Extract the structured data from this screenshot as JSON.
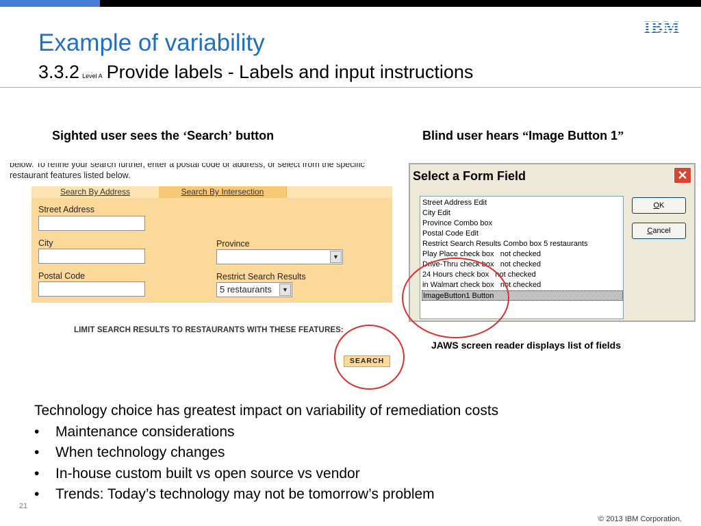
{
  "logo": {
    "text": "IBM",
    "color": "#1f70c1"
  },
  "title": {
    "main": "Example of variability",
    "sub_number": "3.3.2",
    "level": "Level A",
    "sub_text": "Provide labels -  Labels and input instructions"
  },
  "captions": {
    "left_prefix": "Sighted user sees the ",
    "left_quote_open": "‘",
    "left_term": "Search",
    "left_quote_close": "’",
    "left_suffix": " button",
    "right_prefix": "Blind user hears ",
    "right_quote_open": "“",
    "right_term": "Image Button 1",
    "right_quote_close": "”"
  },
  "web_form": {
    "intro_line1": "below. To refine your search further, enter a postal code or address, or select from the specific",
    "intro_line2": "restaurant features listed below.",
    "tabs": [
      "Search By Address",
      "Search By Intersection"
    ],
    "fields": {
      "street_label": "Street Address",
      "city_label": "City",
      "postal_label": "Postal Code",
      "province_label": "Province",
      "restrict_label": "Restrict Search Results",
      "restrict_value": "5 restaurants"
    },
    "limit_text": "LIMIT SEARCH RESULTS TO RESTAURANTS WITH THESE FEATURES:",
    "search_button": "SEARCH"
  },
  "dialog": {
    "title": "Select a Form Field",
    "close": "✕",
    "items": [
      "Street Address Edit",
      "City Edit",
      "Province Combo box",
      "Postal Code Edit",
      "Restrict Search Results Combo box 5 restaurants",
      "Play Place check box   not checked",
      "Drive-Thru check box   not checked",
      "24 Hours check box   not checked",
      "in Walmart check box   not checked",
      "ImageButton1 Button"
    ],
    "selected_index": 9,
    "ok_label": "OK",
    "ok_accel": "O",
    "ok_rest": "K",
    "cancel_accel": "C",
    "cancel_rest": "ancel"
  },
  "jaws_caption": "JAWS screen reader displays list of fields",
  "body": {
    "lead": "Technology choice has greatest impact on variability of remediation costs",
    "bullets": [
      "Maintenance considerations",
      "When technology changes",
      "In-house custom built vs open source vs vendor",
      "Trends: Today’s technology may not be tomorrow’s problem"
    ]
  },
  "footer": {
    "slide_number": "21",
    "copyright": "© 2013 IBM Corporation."
  },
  "colors": {
    "title_blue": "#1f6fc5",
    "form_orange": "#fcd89a",
    "circle_red": "#e32b2b",
    "top_bar_blue": "#4b7bd8"
  }
}
